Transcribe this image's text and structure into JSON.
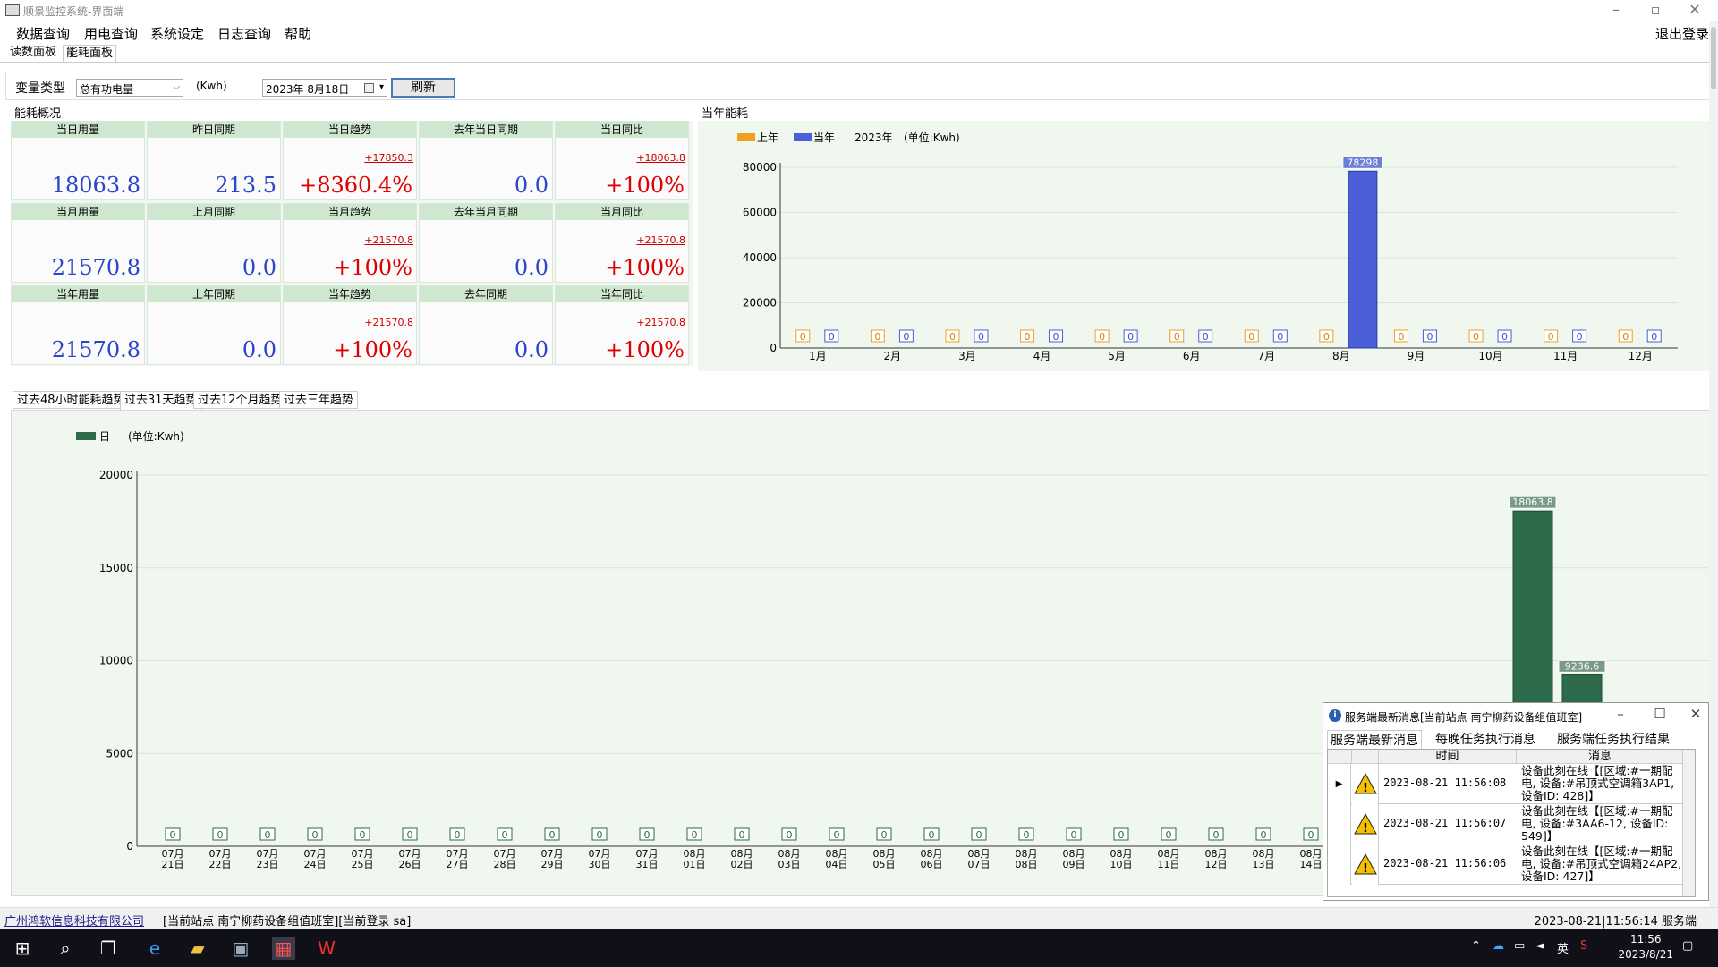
{
  "window": {
    "title": "顺景监控系统-界面端"
  },
  "menu": {
    "items": [
      "数据查询",
      "用电查询",
      "系统设定",
      "日志查询",
      "帮助"
    ],
    "logout": "退出登录"
  },
  "panel_tabs": [
    "读数面板",
    "能耗面板"
  ],
  "toolbar": {
    "var_type_label": "变量类型",
    "var_type_value": "总有功电量",
    "unit": "(Kwh)",
    "date_value": "2023年 8月18日",
    "refresh_label": "刷新"
  },
  "overview": {
    "section_label": "能耗概况",
    "rows": [
      [
        {
          "header": "当日用量",
          "value": "18063.8",
          "delta": "",
          "color": "#2b46c8"
        },
        {
          "header": "昨日同期",
          "value": "213.5",
          "delta": "",
          "color": "#2b46c8"
        },
        {
          "header": "当日趋势",
          "value": "+8360.4%",
          "delta": "+17850.3",
          "color": "#dd0000"
        },
        {
          "header": "去年当日同期",
          "value": "0.0",
          "delta": "",
          "color": "#2b46c8"
        },
        {
          "header": "当日同比",
          "value": "+100%",
          "delta": "+18063.8",
          "color": "#dd0000"
        }
      ],
      [
        {
          "header": "当月用量",
          "value": "21570.8",
          "delta": "",
          "color": "#2b46c8"
        },
        {
          "header": "上月同期",
          "value": "0.0",
          "delta": "",
          "color": "#2b46c8"
        },
        {
          "header": "当月趋势",
          "value": "+100%",
          "delta": "+21570.8",
          "color": "#dd0000"
        },
        {
          "header": "去年当月同期",
          "value": "0.0",
          "delta": "",
          "color": "#2b46c8"
        },
        {
          "header": "当月同比",
          "value": "+100%",
          "delta": "+21570.8",
          "color": "#dd0000"
        }
      ],
      [
        {
          "header": "当年用量",
          "value": "21570.8",
          "delta": "",
          "color": "#2b46c8"
        },
        {
          "header": "上年同期",
          "value": "0.0",
          "delta": "",
          "color": "#2b46c8"
        },
        {
          "header": "当年趋势",
          "value": "+100%",
          "delta": "+21570.8",
          "color": "#dd0000"
        },
        {
          "header": "去年同期",
          "value": "0.0",
          "delta": "",
          "color": "#2b46c8"
        },
        {
          "header": "当年同比",
          "value": "+100%",
          "delta": "+21570.8",
          "color": "#dd0000"
        }
      ]
    ]
  },
  "year_section_label": "当年能耗",
  "trend_tabs": [
    "过去48小时能耗趋势",
    "过去31天趋势",
    "过去12个月趋势",
    "过去三年趋势"
  ],
  "chart_data": [
    {
      "type": "bar",
      "legend": [
        "上年",
        "当年"
      ],
      "legend_extra": [
        "2023年",
        "(单位:Kwh)"
      ],
      "categories": [
        "1月",
        "2月",
        "3月",
        "4月",
        "5月",
        "6月",
        "7月",
        "8月",
        "9月",
        "10月",
        "11月",
        "12月"
      ],
      "series": [
        {
          "name": "上年",
          "values": [
            0,
            0,
            0,
            0,
            0,
            0,
            0,
            0,
            0,
            0,
            0,
            0
          ],
          "color": "#f0a020"
        },
        {
          "name": "当年",
          "values": [
            0,
            0,
            0,
            0,
            0,
            0,
            0,
            78298,
            0,
            0,
            0,
            0
          ],
          "color": "#4a5fd8"
        }
      ],
      "ylim": [
        0,
        80000
      ],
      "yticks": [
        0,
        20000,
        40000,
        60000,
        80000
      ],
      "data_labels": [
        "0",
        "0",
        "0",
        "0",
        "0",
        "0",
        "0",
        "78298",
        "0",
        "0",
        "0",
        "0"
      ]
    },
    {
      "type": "bar",
      "legend": [
        "日"
      ],
      "legend_extra": [
        "(单位:Kwh)"
      ],
      "categories": [
        "07月21日",
        "07月22日",
        "07月23日",
        "07月24日",
        "07月25日",
        "07月26日",
        "07月27日",
        "07月28日",
        "07月29日",
        "07月30日",
        "07月31日",
        "08月01日",
        "08月02日",
        "08月03日",
        "08月04日",
        "08月05日",
        "08月06日",
        "08月07日",
        "08月08日",
        "08月09日",
        "08月10日",
        "08月11日",
        "08月12日",
        "08月13日",
        "08月14日"
      ],
      "series": [
        {
          "name": "日",
          "values": [
            0,
            0,
            0,
            0,
            0,
            0,
            0,
            0,
            0,
            0,
            0,
            0,
            0,
            0,
            0,
            0,
            0,
            0,
            0,
            0,
            0,
            0,
            0,
            0,
            0
          ],
          "color": "#2e6b4a"
        }
      ],
      "extra_bars": [
        {
          "value": 18063.8,
          "label": "18063.8"
        },
        {
          "value": 9236.6,
          "label": "9236.6"
        }
      ],
      "ylim": [
        0,
        20000
      ],
      "yticks": [
        0,
        5000,
        10000,
        15000,
        20000
      ],
      "data_labels": [
        "0",
        "0",
        "0",
        "0",
        "0",
        "0",
        "0",
        "0",
        "0",
        "0",
        "0",
        "0",
        "0",
        "0",
        "0",
        "0",
        "0",
        "0",
        "0",
        "0",
        "0",
        "0",
        "0",
        "0",
        "0"
      ]
    }
  ],
  "message_dialog": {
    "title": "服务端最新消息[当前站点 南宁柳药设备组值班室]",
    "tabs": [
      "服务端最新消息",
      "每晚任务执行消息",
      "服务端任务执行结果"
    ],
    "columns": [
      "时间",
      "消息"
    ],
    "rows": [
      {
        "time": "2023-08-21 11:56:08",
        "message": "设备此刻在线【[区域:#一期配电, 设备:#吊顶式空调箱3AP1, 设备ID: 428]】"
      },
      {
        "time": "2023-08-21 11:56:07",
        "message": "设备此刻在线【[区域:#一期配电, 设备:#3AA6-12, 设备ID: 549]】"
      },
      {
        "time": "2023-08-21 11:56:06",
        "message": "设备此刻在线【[区域:#一期配电, 设备:#吊顶式空调箱24AP2, 设备ID: 427]】"
      }
    ]
  },
  "statusbar": {
    "company": "广州鸿软信息科技有限公司",
    "station": "[当前站点  南宁柳药设备组值班室][当前登录  sa]",
    "right": "2023-08-21|11:56:14 服务端"
  },
  "taskbar": {
    "time": "11:56",
    "date": "2023/8/21",
    "ime": "英"
  }
}
